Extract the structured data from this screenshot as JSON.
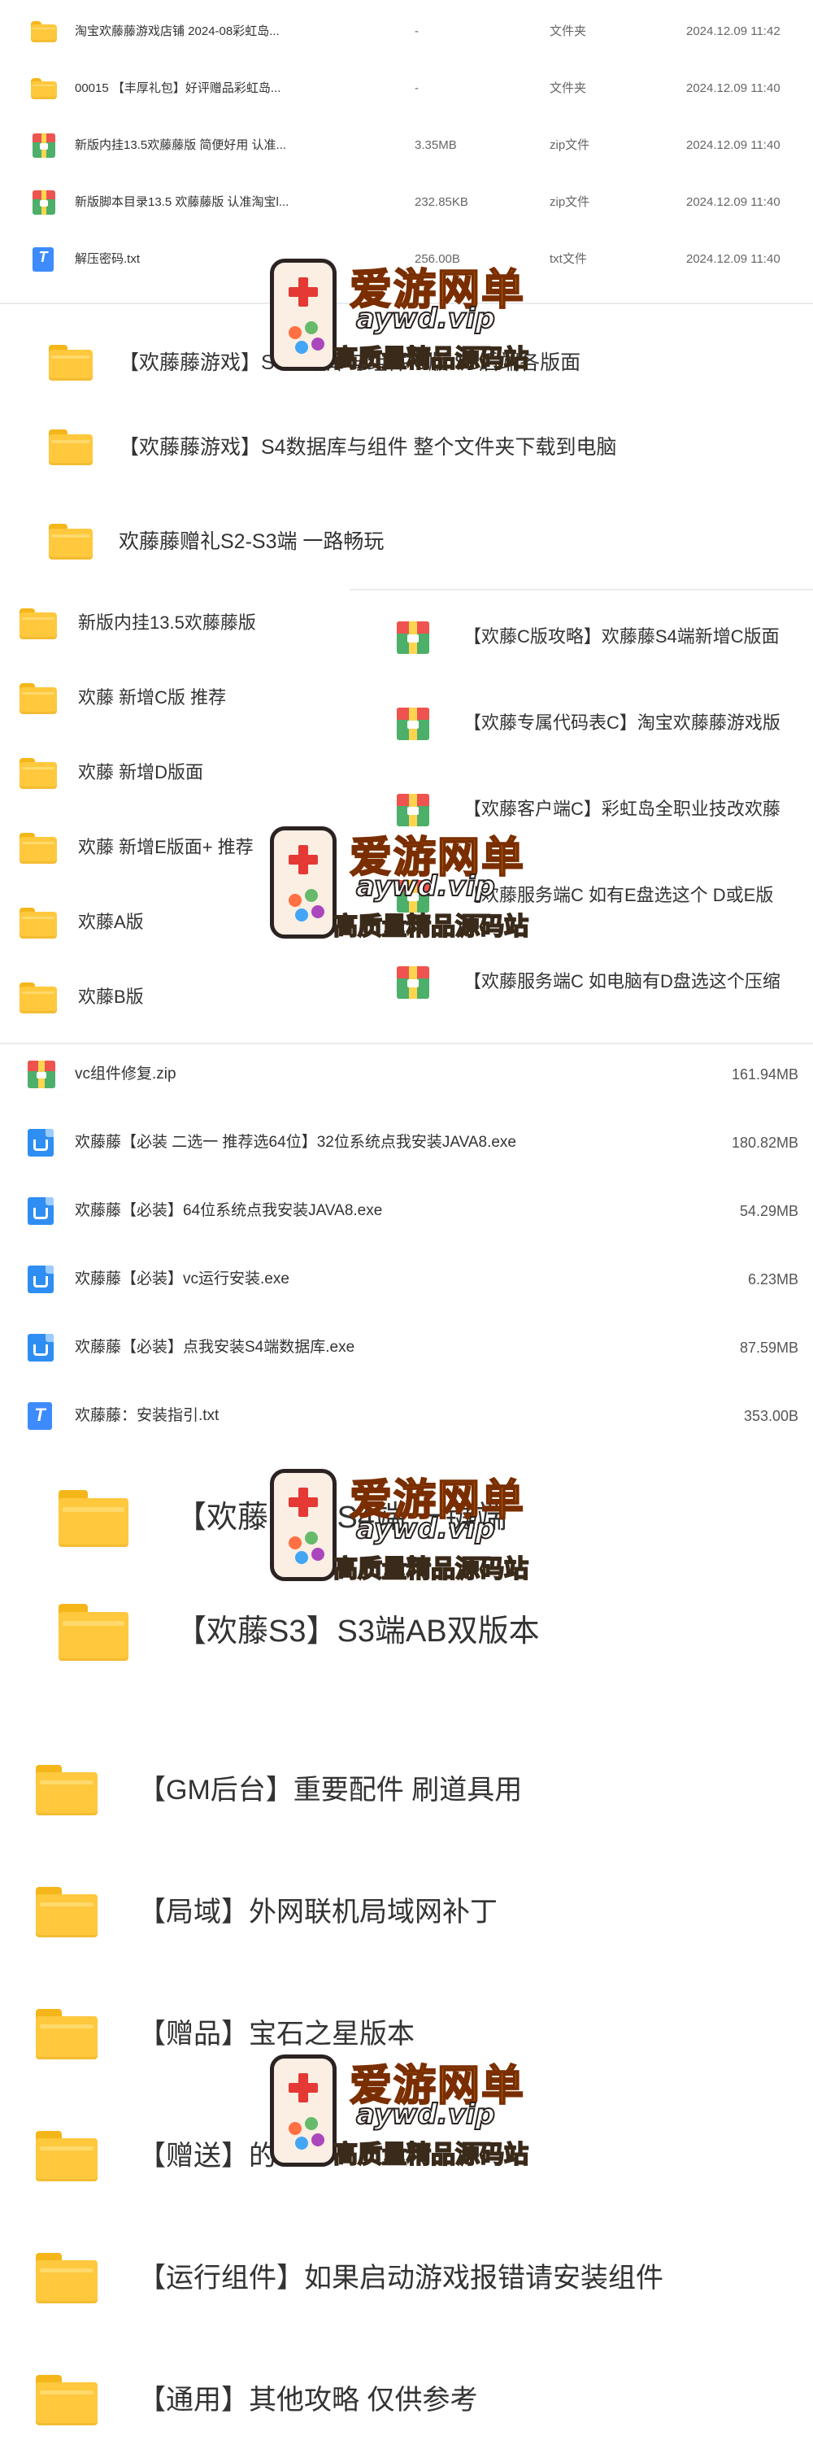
{
  "table1": {
    "rows": [
      {
        "icon": "folder-icon",
        "name": "淘宝欢藤藤游戏店铺 2024-08彩虹岛...",
        "size": "-",
        "type": "文件夹",
        "date": "2024.12.09 11:42"
      },
      {
        "icon": "folder-icon",
        "name": "00015 【丰厚礼包】好评赠品彩虹岛...",
        "size": "-",
        "type": "文件夹",
        "date": "2024.12.09 11:40"
      },
      {
        "icon": "zip-icon",
        "name": "新版内挂13.5欢藤藤版 简便好用 认准...",
        "size": "3.35MB",
        "type": "zip文件",
        "date": "2024.12.09 11:40"
      },
      {
        "icon": "zip-icon",
        "name": "新版脚本目录13.5 欢藤藤版 认准淘宝l...",
        "size": "232.85KB",
        "type": "zip文件",
        "date": "2024.12.09 11:40"
      },
      {
        "icon": "txt-icon",
        "name": "解压密码.txt",
        "size": "256.00B",
        "type": "txt文件",
        "date": "2024.12.09 11:40"
      }
    ]
  },
  "folders2": [
    "【欢藤藤游戏】S4数据库与组件 C版 S3后端各版面",
    "【欢藤藤游戏】S4数据库与组件 整个文件夹下载到电脑",
    "欢藤藤赠礼S2-S3端 一路畅玩"
  ],
  "left3": [
    "新版内挂13.5欢藤藤版",
    "欢藤 新增C版 推荐",
    "欢藤 新增D版面",
    "欢藤 新增E版面+ 推荐",
    "欢藤A版",
    "欢藤B版"
  ],
  "right3": [
    "【欢藤C版攻略】欢藤藤S4端新增C版面",
    "【欢藤专属代码表C】淘宝欢藤藤游戏版",
    "【欢藤客户端C】彩虹岛全职业技改欢藤",
    "【欢藤服务端C 如有E盘选这个 D或E版",
    "【欢藤服务端C 如电脑有D盘选这个压缩"
  ],
  "files4": [
    {
      "icon": "zip-icon",
      "name": "vc组件修复.zip",
      "size": "161.94MB"
    },
    {
      "icon": "exe-icon",
      "name": "欢藤藤【必装 二选一 推荐选64位】32位系统点我安装JAVA8.exe",
      "size": "180.82MB"
    },
    {
      "icon": "exe-icon",
      "name": "欢藤藤【必装】64位系统点我安装JAVA8.exe",
      "size": "54.29MB"
    },
    {
      "icon": "exe-icon",
      "name": "欢藤藤【必装】vc运行安装.exe",
      "size": "6.23MB"
    },
    {
      "icon": "exe-icon",
      "name": "欢藤藤【必装】点我安装S4端数据库.exe",
      "size": "87.59MB"
    },
    {
      "icon": "txt-icon",
      "name": "欢藤藤：安装指引.txt",
      "size": "353.00B"
    }
  ],
  "folders5": [
    "【欢藤S4】S4端 一键端",
    "【欢藤S3】S3端AB双版本"
  ],
  "folders6": [
    "【GM后台】重要配件 刷道具用",
    "【局域】外网联机局域网补丁",
    "【赠品】宝石之星版本",
    "【赠送】的",
    "【运行组件】如果启动游戏报错请安装组件",
    "【通用】其他攻略 仅供参考"
  ],
  "watermark": {
    "logo": "爱游网单",
    "domain": "aywd.vip",
    "slogan": "高质量精品源码站"
  },
  "colors": {
    "folder": "#ffc83d",
    "exe": "#2f8ef2",
    "txt": "#3d8bfd",
    "zip": "#4caf6a"
  }
}
